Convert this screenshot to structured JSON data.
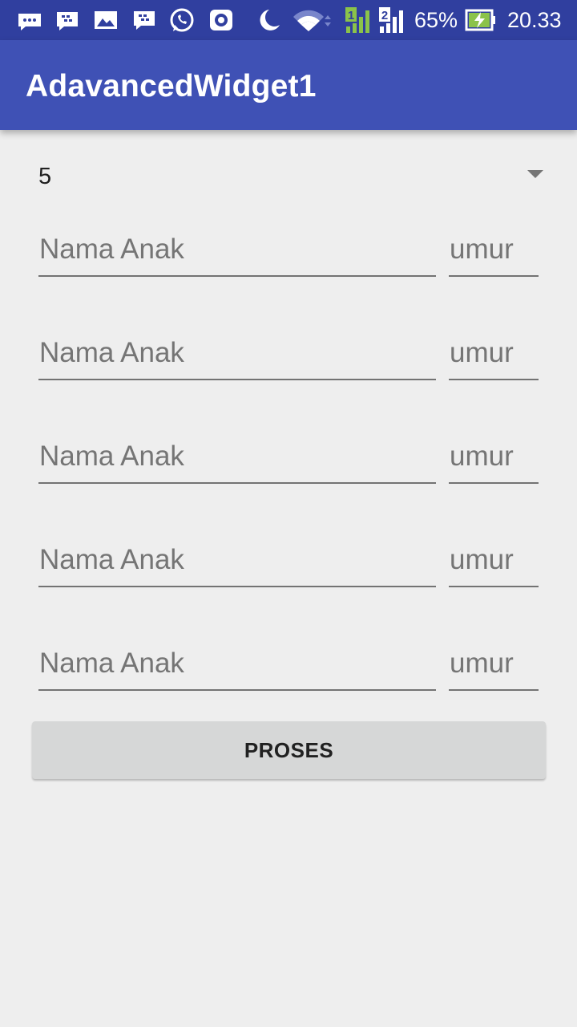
{
  "status_bar": {
    "battery": "65%",
    "time": "20.33",
    "sim1": "1",
    "sim2": "2"
  },
  "app_bar": {
    "title": "AdavancedWidget1"
  },
  "spinner": {
    "value": "5"
  },
  "rows": [
    {
      "name_placeholder": "Nama Anak",
      "age_placeholder": "umur"
    },
    {
      "name_placeholder": "Nama Anak",
      "age_placeholder": "umur"
    },
    {
      "name_placeholder": "Nama Anak",
      "age_placeholder": "umur"
    },
    {
      "name_placeholder": "Nama Anak",
      "age_placeholder": "umur"
    },
    {
      "name_placeholder": "Nama Anak",
      "age_placeholder": "umur"
    }
  ],
  "button": {
    "label": "PROSES"
  },
  "colors": {
    "status_bar": "#303f9f",
    "app_bar": "#3f51b5",
    "background": "#eeeeee",
    "button": "#d6d7d7",
    "signal_green": "#8bc34a"
  }
}
